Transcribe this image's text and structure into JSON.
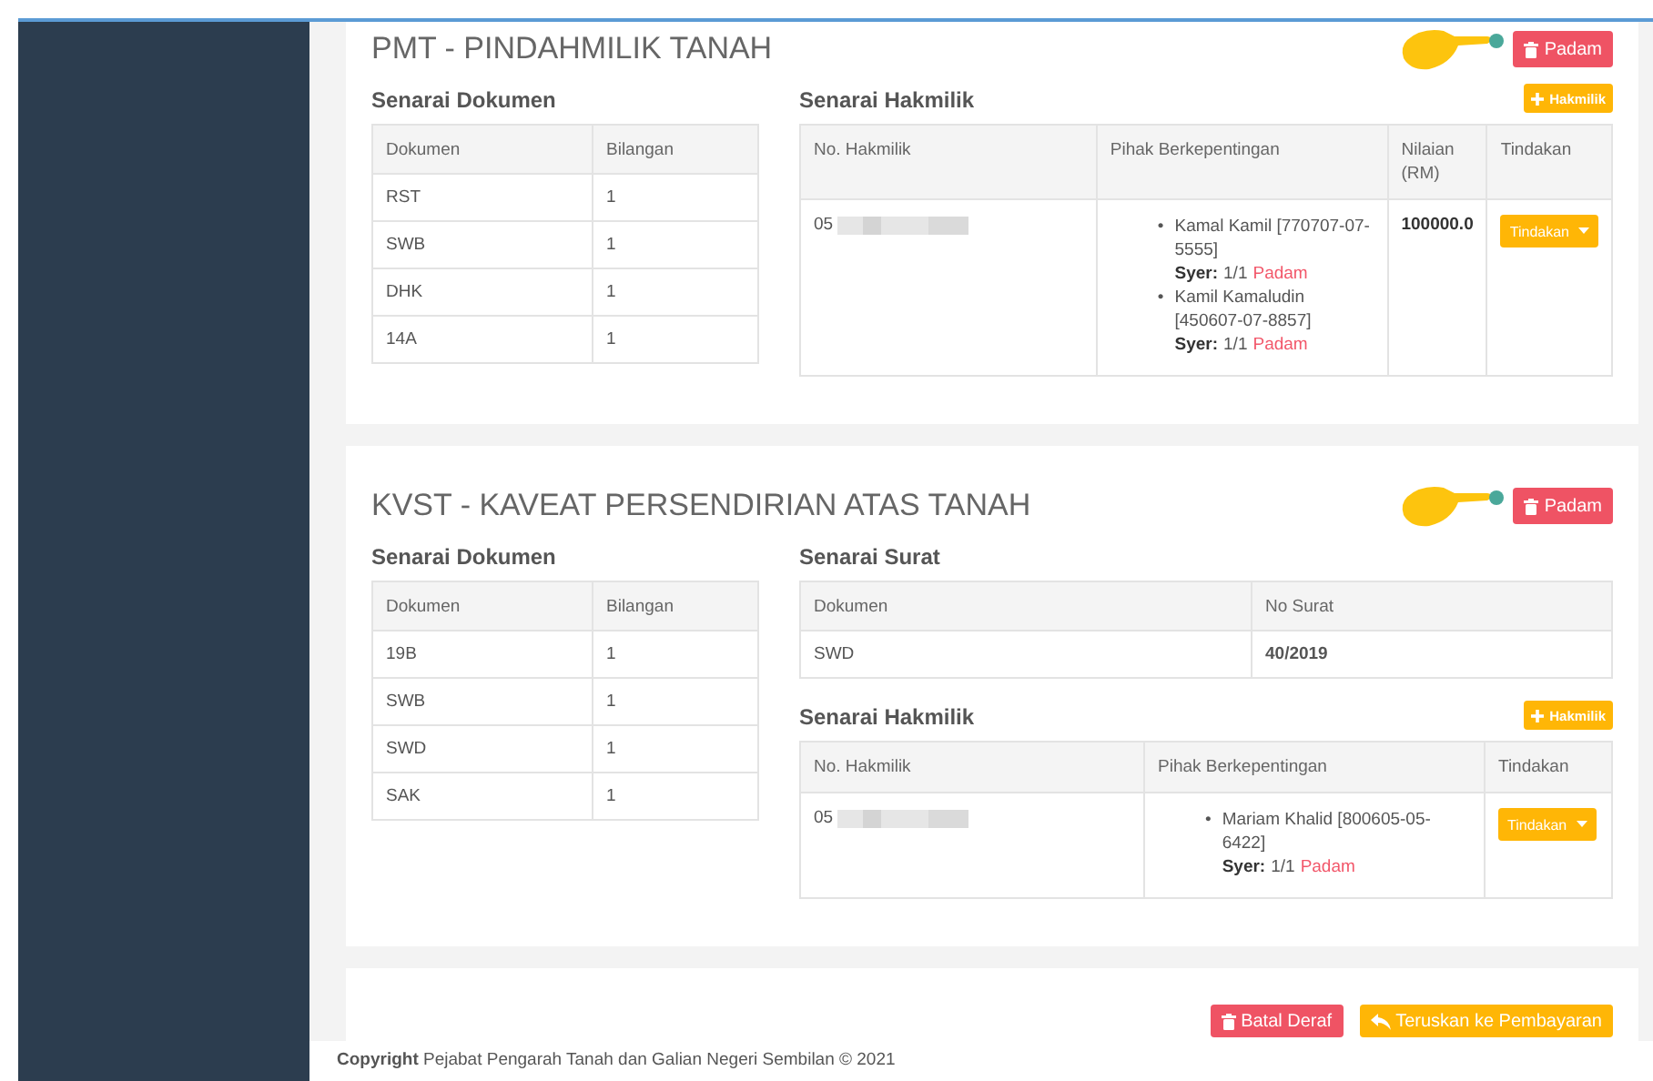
{
  "sections": [
    {
      "title": "PMT - PINDAHMILIK TANAH",
      "delete_button": "Padam",
      "documents": {
        "heading": "Senarai Dokumen",
        "columns": [
          "Dokumen",
          "Bilangan"
        ],
        "rows": [
          [
            "RST",
            "1"
          ],
          [
            "SWB",
            "1"
          ],
          [
            "DHK",
            "1"
          ],
          [
            "14A",
            "1"
          ]
        ]
      },
      "titles": {
        "heading": "Senarai Hakmilik",
        "add_button": "Hakmilik",
        "columns": [
          {
            "label": "No. Hakmilik",
            "kind": "number"
          },
          {
            "label": "Pihak Berkepentingan",
            "kind": "parties"
          },
          {
            "label": "Nilaian (RM)",
            "kind": "value"
          },
          {
            "label": "Tindakan",
            "kind": "action"
          }
        ],
        "rows": [
          {
            "number": "05",
            "parties": [
              {
                "marker": "•",
                "name": "Kamal Kamil [770707-07-5555]",
                "share_label": "Syer:",
                "share": "1/1",
                "remove": "Padam"
              },
              {
                "marker": "•",
                "name": "Kamil Kamaludin [450607-07-8857]",
                "share_label": "Syer:",
                "share": "1/1",
                "remove": "Padam"
              }
            ],
            "value": "100000.0",
            "action": "Tindakan"
          }
        ]
      }
    },
    {
      "title": "KVST - KAVEAT PERSENDIRIAN ATAS TANAH",
      "delete_button": "Padam",
      "documents": {
        "heading": "Senarai Dokumen",
        "columns": [
          "Dokumen",
          "Bilangan"
        ],
        "rows": [
          [
            "19B",
            "1"
          ],
          [
            "SWB",
            "1"
          ],
          [
            "SWD",
            "1"
          ],
          [
            "SAK",
            "1"
          ]
        ]
      },
      "letters": {
        "heading": "Senarai Surat",
        "columns": [
          "Dokumen",
          "No Surat"
        ],
        "rows": [
          [
            "SWD",
            "40/2019"
          ]
        ]
      },
      "titles": {
        "heading": "Senarai Hakmilik",
        "add_button": "Hakmilik",
        "columns": [
          {
            "label": "No. Hakmilik",
            "kind": "number"
          },
          {
            "label": "Pihak Berkepentingan",
            "kind": "parties"
          },
          {
            "label": "Tindakan",
            "kind": "action"
          }
        ],
        "rows": [
          {
            "number": "05",
            "parties": [
              {
                "marker": "•",
                "name": "Mariam Khalid [800605-05-6422]",
                "share_label": "Syer:",
                "share": "1/1",
                "remove": "Padam"
              }
            ],
            "action": "Tindakan"
          }
        ]
      }
    }
  ],
  "actions": {
    "cancel_button": "Batal Deraf",
    "proceed_button": "Teruskan ke Pembayaran"
  },
  "footer": "**Copyright** Pejabat Pengarah Tanah dan Galian Negeri Sembilan © 2021"
}
